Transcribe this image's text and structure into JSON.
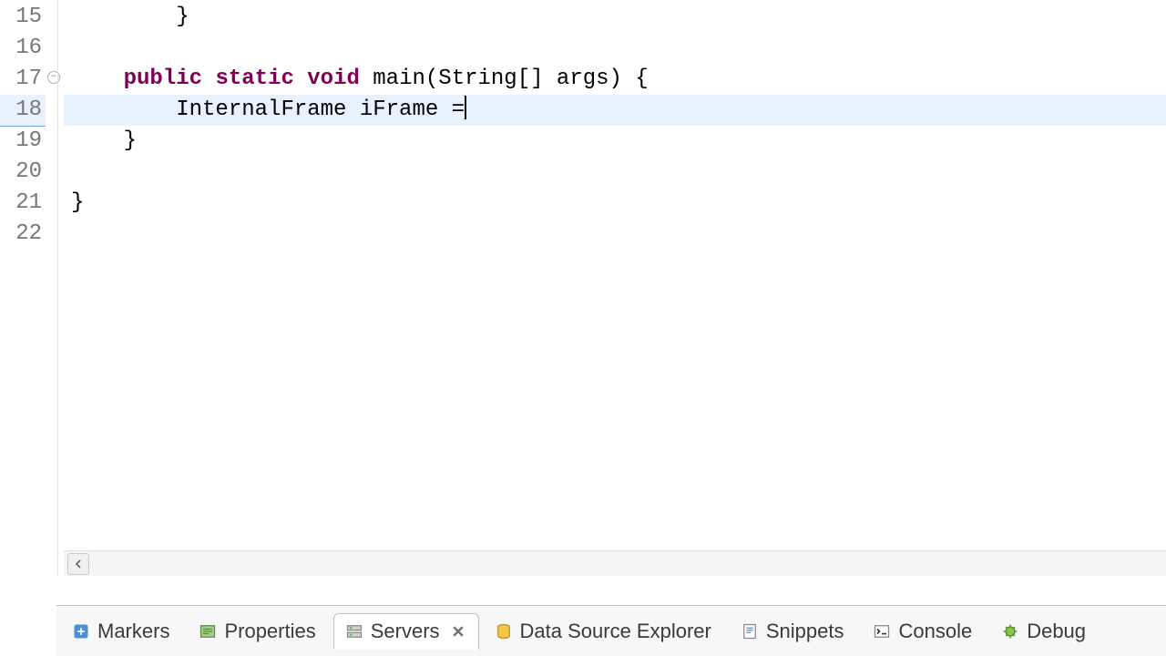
{
  "editor": {
    "lines": [
      {
        "num": "15",
        "indent": "        ",
        "tokens": [
          {
            "cls": "plain",
            "t": "}"
          }
        ]
      },
      {
        "num": "16",
        "indent": "",
        "tokens": []
      },
      {
        "num": "17",
        "indent": "    ",
        "fold": true,
        "tokens": [
          {
            "cls": "kw",
            "t": "public"
          },
          {
            "cls": "plain",
            "t": " "
          },
          {
            "cls": "kw",
            "t": "static"
          },
          {
            "cls": "plain",
            "t": " "
          },
          {
            "cls": "kw",
            "t": "void"
          },
          {
            "cls": "plain",
            "t": " main(String[] args) {"
          }
        ]
      },
      {
        "num": "18",
        "indent": "        ",
        "current": true,
        "caret": true,
        "tokens": [
          {
            "cls": "plain",
            "t": "InternalFrame iFrame ="
          }
        ]
      },
      {
        "num": "19",
        "indent": "    ",
        "tokens": [
          {
            "cls": "plain",
            "t": "}"
          }
        ]
      },
      {
        "num": "20",
        "indent": "",
        "tokens": []
      },
      {
        "num": "21",
        "indent": "",
        "tokens": [
          {
            "cls": "plain",
            "t": "}"
          }
        ]
      },
      {
        "num": "22",
        "indent": "",
        "tokens": []
      }
    ]
  },
  "tabs": [
    {
      "id": "markers",
      "label": "Markers",
      "icon": "markers-icon"
    },
    {
      "id": "properties",
      "label": "Properties",
      "icon": "properties-icon"
    },
    {
      "id": "servers",
      "label": "Servers",
      "icon": "servers-icon",
      "active": true,
      "closeable": true
    },
    {
      "id": "dse",
      "label": "Data Source Explorer",
      "icon": "datasource-icon"
    },
    {
      "id": "snippets",
      "label": "Snippets",
      "icon": "snippets-icon"
    },
    {
      "id": "console",
      "label": "Console",
      "icon": "console-icon"
    },
    {
      "id": "debug",
      "label": "Debug",
      "icon": "debug-icon"
    }
  ]
}
